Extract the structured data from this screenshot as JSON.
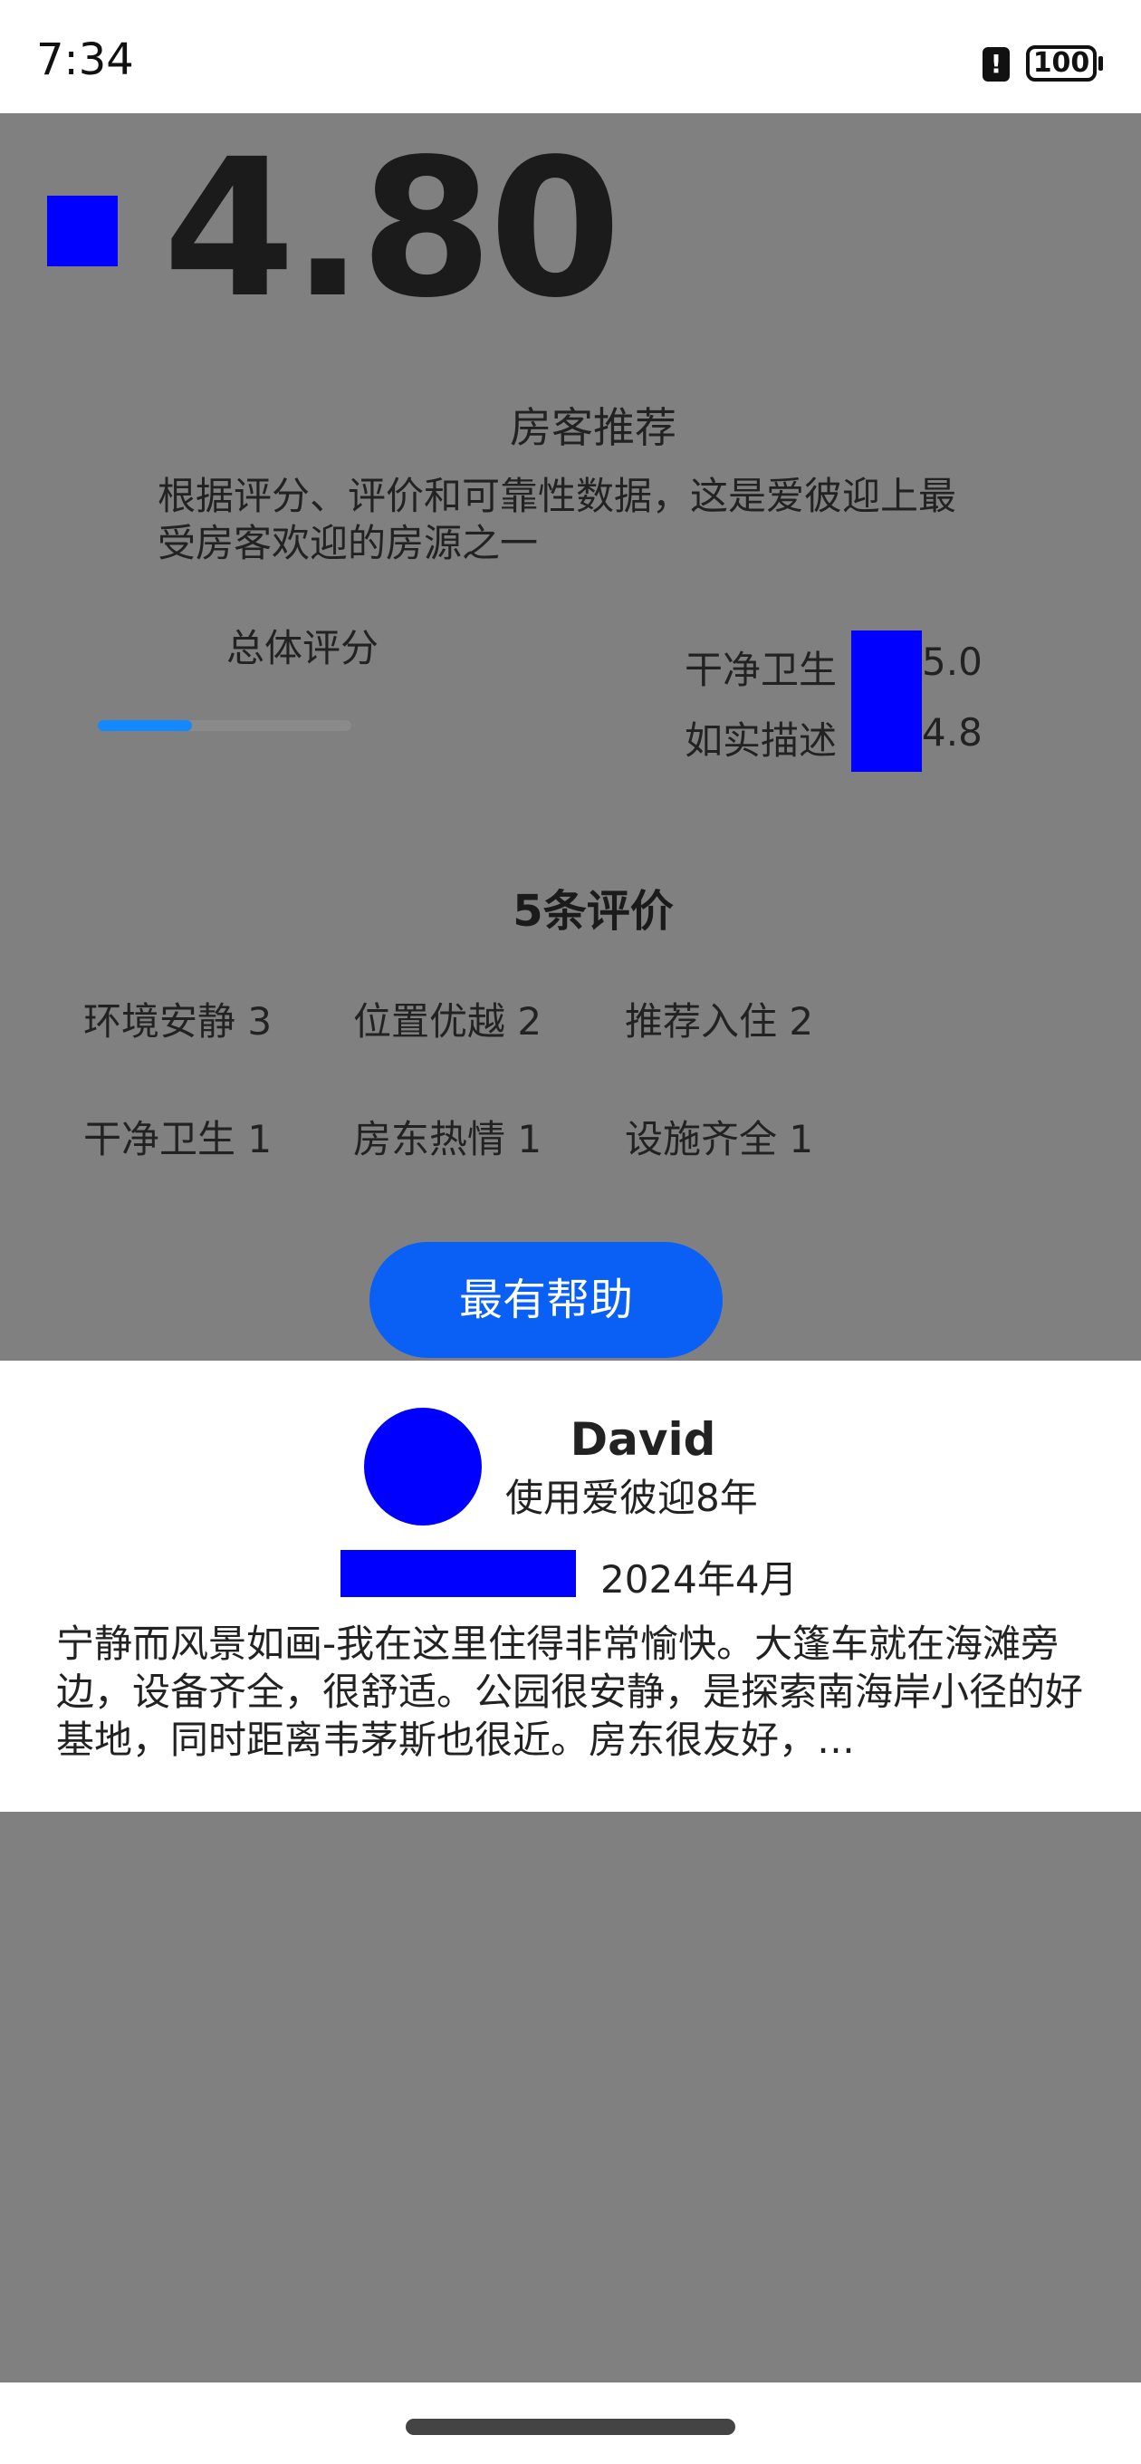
{
  "status_bar": {
    "time": "7:34",
    "alert_glyph": "!",
    "battery": "100"
  },
  "listing": {
    "overall_rating": "4.80",
    "guest_favorite_title": "房客推荐",
    "guest_favorite_desc": "根据评分、评价和可靠性数据，这是爱彼迎上最受房客欢迎的房源之一",
    "overall_label": "总体评分",
    "overall_progress_fraction": 0.37,
    "sub_ratings": [
      {
        "label": "干净卫生",
        "value": "5.0"
      },
      {
        "label": "如实描述",
        "value": "4.8"
      }
    ],
    "reviews_count_label": "5条评价",
    "tags": [
      {
        "label": "环境安静 3"
      },
      {
        "label": "位置优越 2"
      },
      {
        "label": "推荐入住 2"
      },
      {
        "label": "干净卫生 1"
      },
      {
        "label": "房东热情 1"
      },
      {
        "label": "设施齐全 1"
      }
    ],
    "sort_button": "最有帮助"
  },
  "review": {
    "name": "David",
    "tenure": "使用爱彼迎8年",
    "date": "2024年4月",
    "text": "宁静而风景如画-我在这里住得非常愉快。大篷车就在海滩旁边，设备齐全，很舒适。公园很安静，是探索南海岸小径的好基地，同时距离韦茅斯也很近。房东很友好，…"
  },
  "colors": {
    "overlay_gray": "#808080",
    "placeholder_blue": "#0000ff",
    "primary_button": "#0a5ff5",
    "progress_fill": "#1488ff"
  }
}
